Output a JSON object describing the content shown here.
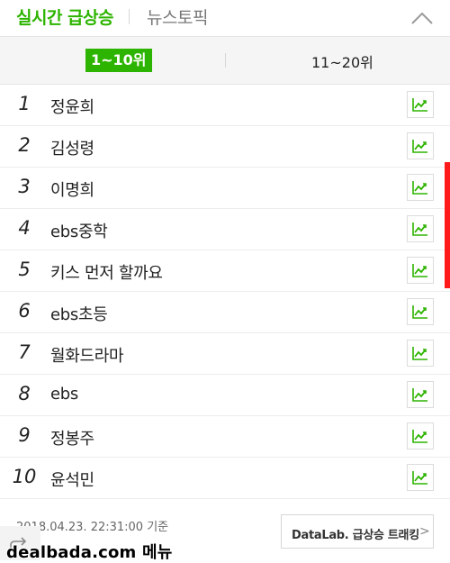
{
  "header": {
    "active_tab": "실시간 급상승",
    "inactive_tab": "뉴스토픽",
    "collapse_icon": "chevron-up-icon"
  },
  "range_tabs": {
    "left": "1~10위",
    "right": "11~20위",
    "active_color": "#2db400"
  },
  "ranking": [
    {
      "rank": "1",
      "keyword": "정윤희"
    },
    {
      "rank": "2",
      "keyword": "김성령"
    },
    {
      "rank": "3",
      "keyword": "이명희"
    },
    {
      "rank": "4",
      "keyword": "ebs중학"
    },
    {
      "rank": "5",
      "keyword": "키스 먼저 할까요"
    },
    {
      "rank": "6",
      "keyword": "ebs초등"
    },
    {
      "rank": "7",
      "keyword": "월화드라마"
    },
    {
      "rank": "8",
      "keyword": "ebs"
    },
    {
      "rank": "9",
      "keyword": "정봉주"
    },
    {
      "rank": "10",
      "keyword": "윤석민"
    }
  ],
  "trend_icon": "trend-chart-icon",
  "footer": {
    "timestamp": "2018.04.23. 22:31:00 기준",
    "datalab_button": "DataLab. 급상승 트래킹",
    "datalab_chevron": ">"
  },
  "watermark": "dealbada.com 메뉴"
}
